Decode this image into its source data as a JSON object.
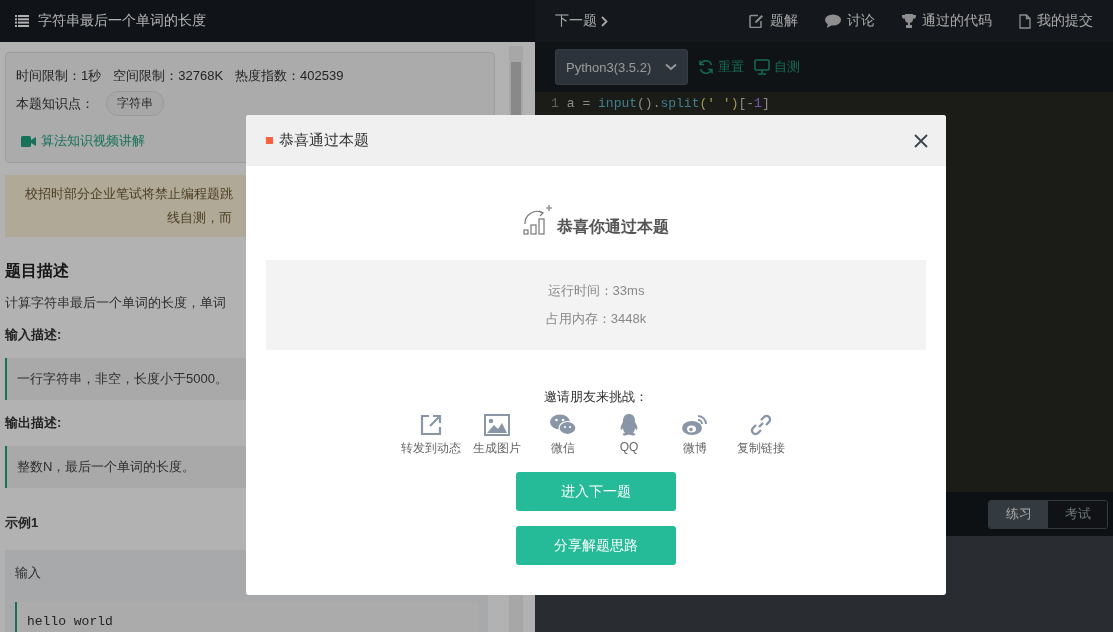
{
  "problem_header": {
    "title": "字符串最后一个单词的长度"
  },
  "info_card": {
    "limits": [
      {
        "label": "时间限制：",
        "value": "1秒"
      },
      {
        "label": "空间限制：",
        "value": "32768K"
      },
      {
        "label": "热度指数：",
        "value": "402539"
      }
    ],
    "topic_label": "本题知识点：",
    "topic_tag": "字符串",
    "video_link": "算法知识视频讲解"
  },
  "notice": {
    "lines": [
      "校招时部分企业笔试将禁止编程题跳",
      "线自测，而"
    ]
  },
  "description": {
    "heading": "题目描述",
    "text": "计算字符串最后一个单词的长度，单词",
    "input_heading": "输入描述:",
    "input_text": "一行字符串，非空，长度小于5000。",
    "output_heading": "输出描述:",
    "output_text": "整数N，最后一个单词的长度。"
  },
  "example": {
    "heading": "示例1",
    "input_label": "输入",
    "input_value": "hello world"
  },
  "editor_header": {
    "next_link": "下一题",
    "nav": [
      {
        "label": "题解"
      },
      {
        "label": "讨论"
      },
      {
        "label": "通过的代码"
      },
      {
        "label": "我的提交"
      }
    ]
  },
  "toolbar": {
    "language": "Python3(3.5.2)",
    "reset": "重置",
    "self_test": "自测"
  },
  "code_lines": [
    {
      "number": "1",
      "tokens": [
        {
          "text": "a",
          "kind": "plain"
        },
        {
          "text": " = ",
          "kind": "op"
        },
        {
          "text": "input",
          "kind": "func"
        },
        {
          "text": "().",
          "kind": "plain"
        },
        {
          "text": "split",
          "kind": "func"
        },
        {
          "text": "(' ')",
          "kind": "string"
        },
        {
          "text": "[-",
          "kind": "plain"
        },
        {
          "text": "1",
          "kind": "number"
        },
        {
          "text": "]",
          "kind": "plain"
        }
      ]
    }
  ],
  "mode_tabs": [
    {
      "label": "练习",
      "selected": true
    },
    {
      "label": "考试",
      "selected": false
    }
  ],
  "dialog": {
    "title": "恭喜通过本题",
    "headline": "恭喜你通过本题",
    "stats": [
      "运行时间：33ms",
      "占用内存：3448k"
    ],
    "invite": "邀请朋友来挑战：",
    "share": [
      {
        "label": "转发到动态",
        "kind": "forward"
      },
      {
        "label": "生成图片",
        "kind": "image"
      },
      {
        "label": "微信",
        "kind": "wechat"
      },
      {
        "label": "QQ",
        "kind": "qq"
      },
      {
        "label": "微博",
        "kind": "weibo"
      },
      {
        "label": "复制链接",
        "kind": "link"
      }
    ],
    "buttons": [
      "进入下一题",
      "分享解题思路"
    ]
  }
}
